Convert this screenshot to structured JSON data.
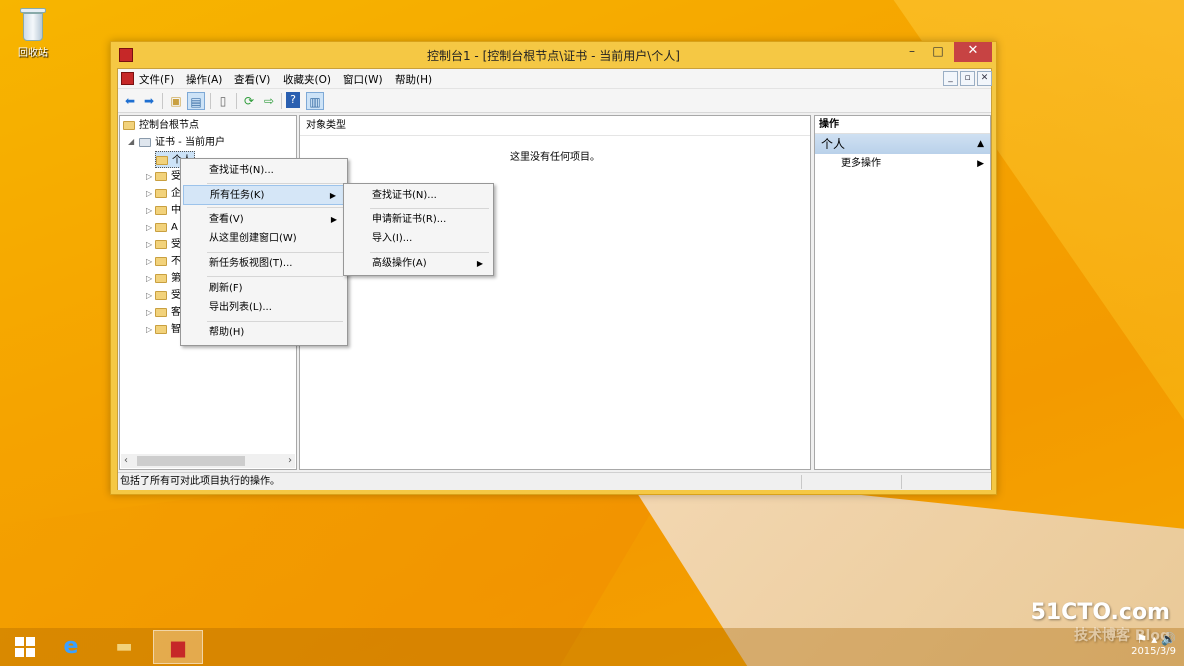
{
  "desktop": {
    "recycle_bin_label": "回收站"
  },
  "window": {
    "title": "控制台1 - [控制台根节点\\证书 - 当前用户\\个人]",
    "min": "–",
    "max": "□",
    "close": "✕"
  },
  "menubar": {
    "items": [
      "文件(F)",
      "操作(A)",
      "查看(V)",
      "收藏夹(O)",
      "窗口(W)",
      "帮助(H)"
    ],
    "mdi": [
      "_",
      "▫",
      "✕"
    ]
  },
  "tree": {
    "root": "控制台根节点",
    "cert_node": "证书 - 当前用户",
    "children": [
      "个人",
      "受",
      "企",
      "中",
      "A",
      "受",
      "不",
      "第",
      "受",
      "客",
      "智"
    ]
  },
  "center": {
    "column_header": "对象类型",
    "empty_message": "这里没有任何项目。"
  },
  "actions": {
    "title": "操作",
    "section": "个人",
    "more": "更多操作"
  },
  "status": {
    "text": "包括了所有可对此项目执行的操作。"
  },
  "context_menu": {
    "items": [
      "查找证书(N)...",
      "所有任务(K)",
      "查看(V)",
      "从这里创建窗口(W)",
      "新任务板视图(T)...",
      "刷新(F)",
      "导出列表(L)...",
      "帮助(H)"
    ]
  },
  "submenu": {
    "items": [
      "查找证书(N)...",
      "申请新证书(R)...",
      "导入(I)...",
      "高级操作(A)"
    ]
  },
  "taskbar": {
    "date": "2015/3/9"
  },
  "watermark": {
    "site": "51CTO.com",
    "sub": "技术博客 Blog"
  },
  "colors": {
    "desktop": "#f5a800",
    "window_frame": "#f5c844",
    "highlight": "#d5e6f7",
    "close": "#c74343"
  }
}
